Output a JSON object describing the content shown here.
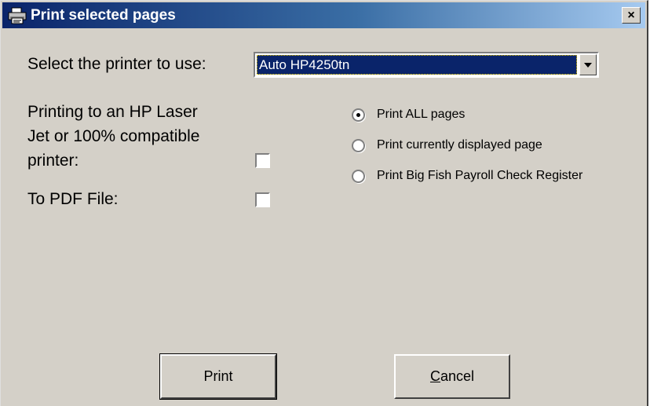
{
  "window": {
    "title": "Print selected pages",
    "close_symbol": "×",
    "title_icon": "printer-icon"
  },
  "printer_select": {
    "label": "Select the printer to use:",
    "selected_value": "Auto HP4250tn",
    "dropdown_icon": "chevron-down-icon"
  },
  "options": {
    "hp_laser_label_lines": [
      "Printing to an HP Laser",
      "Jet or 100% compatible",
      "printer:"
    ],
    "hp_laser_checked": false,
    "pdf_label": "To PDF File:",
    "pdf_checked": false
  },
  "print_range": {
    "items": [
      {
        "label": "Print ALL pages",
        "selected": true
      },
      {
        "label": "Print currently displayed page",
        "selected": false
      },
      {
        "label": "Print Big Fish Payroll Check Register",
        "selected": false
      }
    ]
  },
  "buttons": {
    "print_label": "Print",
    "cancel_mnemonic": "C",
    "cancel_rest": "ancel"
  }
}
